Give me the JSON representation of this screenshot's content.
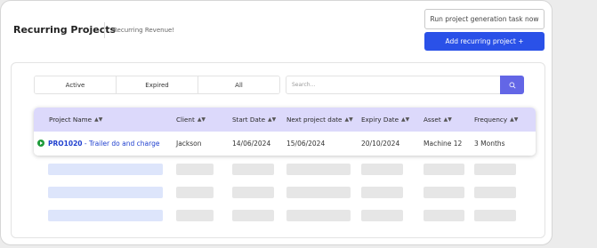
{
  "header": {
    "title": "Recurring Projects",
    "subtitle": "Recurring Revenue!",
    "run_button": "Run project generation task now",
    "add_button": "Add recurring project +"
  },
  "filters": {
    "tabs": [
      "Active",
      "Expired",
      "All"
    ],
    "search_placeholder": "Search..."
  },
  "table": {
    "columns": [
      "Project Name",
      "Client",
      "Start Date",
      "Next project date",
      "Expiry Date",
      "Asset",
      "Frequency"
    ],
    "sort_icon": "sort-updown-icon",
    "rows": [
      {
        "status": "active",
        "project_code": "PRO1020",
        "project_name": " - Trailer do and charge",
        "client": "Jackson",
        "start_date": "14/06/2024",
        "next_date": "15/06/2024",
        "expiry_date": "20/10/2024",
        "asset": "Machine 12",
        "frequency": "3 Months"
      }
    ],
    "skeleton_rows": 3
  },
  "colors": {
    "primary": "#2a51e8",
    "search_button": "#6366e6",
    "header_bg": "#dcd9fb",
    "status_active": "#1e9b3a",
    "link": "#1f3fcf"
  }
}
